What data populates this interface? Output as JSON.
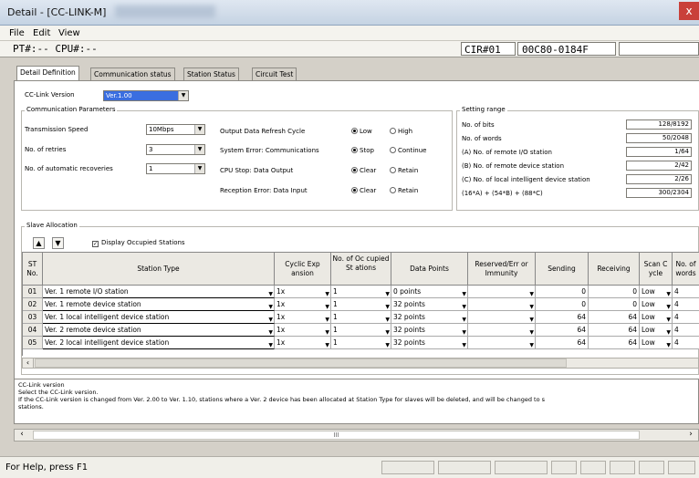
{
  "window": {
    "title": "Detail - [CC-LINK-M]",
    "close_glyph": "x"
  },
  "menu": [
    "File",
    "Edit",
    "View"
  ],
  "pt_bar": {
    "pt_label": "PT#:-- CPU#:--",
    "cir": "CIR#01",
    "code": "00C80-0184F"
  },
  "tabs": [
    "Detail Definition",
    "Communication status",
    "Station Status",
    "Circuit Test"
  ],
  "cc_link_version": {
    "label": "CC-Link Version",
    "value": "Ver.1.00"
  },
  "comm": {
    "group_title": "Communication Parameters",
    "transmission_speed": {
      "label": "Transmission Speed",
      "value": "10Mbps"
    },
    "retries": {
      "label": "No. of retries",
      "value": "3"
    },
    "recoveries": {
      "label": "No. of automatic recoveries",
      "value": "1"
    }
  },
  "options": [
    {
      "label": "Output Data Refresh Cycle",
      "opt1": "Low",
      "opt2": "High"
    },
    {
      "label": "System Error: Communications",
      "opt1": "Stop",
      "opt2": "Continue"
    },
    {
      "label": "CPU Stop: Data Output",
      "opt1": "Clear",
      "opt2": "Retain"
    },
    {
      "label": "Reception Error: Data Input",
      "opt1": "Clear",
      "opt2": "Retain"
    }
  ],
  "setting": {
    "title": "Setting range",
    "rows": [
      {
        "label": "No. of bits",
        "value": "128/8192"
      },
      {
        "label": "No. of words",
        "value": "50/2048"
      },
      {
        "label": "(A) No. of remote I/O station",
        "value": "1/64"
      },
      {
        "label": "(B) No. of remote device station",
        "value": "2/42"
      },
      {
        "label": "(C) No. of local intelligent device station",
        "value": "2/26"
      },
      {
        "label": "(16*A) + (54*B) + (88*C)",
        "value": "300/2304"
      }
    ]
  },
  "slave": {
    "group_title": "Slave Allocation",
    "up_arrow": "▲",
    "down_arrow": "▼",
    "display_occupied": "Display Occupied Stations",
    "headers": [
      "ST No.",
      "Station Type",
      "Cyclic Exp ansion",
      "No. of Oc cupied St ations",
      "Data Points",
      "Reserved/Err or Immunity",
      "Sending",
      "Receiving",
      "Scan C ycle",
      "No. of words"
    ],
    "rows": [
      {
        "st": "01",
        "type": "Ver. 1 remote I/O station",
        "cyclic": "1x",
        "occ": "1",
        "points": "0 points",
        "reserved": "",
        "sending": "0",
        "receiving": "0",
        "scan": "Low",
        "words": "4"
      },
      {
        "st": "02",
        "type": "Ver. 1 remote device station",
        "cyclic": "1x",
        "occ": "1",
        "points": "32 points",
        "reserved": "",
        "sending": "0",
        "receiving": "0",
        "scan": "Low",
        "words": "4"
      },
      {
        "st": "03",
        "type": "Ver. 1 local intelligent device station",
        "cyclic": "1x",
        "occ": "1",
        "points": "32 points",
        "reserved": "",
        "sending": "64",
        "receiving": "64",
        "scan": "Low",
        "words": "4"
      },
      {
        "st": "04",
        "type": "Ver. 2 remote device station",
        "cyclic": "1x",
        "occ": "1",
        "points": "32 points",
        "reserved": "",
        "sending": "64",
        "receiving": "64",
        "scan": "Low",
        "words": "4"
      },
      {
        "st": "05",
        "type": "Ver. 2 local intelligent device station",
        "cyclic": "1x",
        "occ": "1",
        "points": "32 points",
        "reserved": "",
        "sending": "64",
        "receiving": "64",
        "scan": "Low",
        "words": "4"
      }
    ]
  },
  "help": {
    "line1": "CC-Link version",
    "line2": "Select the CC-Link version.",
    "line3": "If the CC-Link version is changed from Ver. 2.00 to Ver. 1.10, stations where a Ver. 2 device has been allocated at Station Type for slaves will be deleted, and will be changed to s",
    "line4": "stations."
  },
  "scrollbar": {
    "left": "‹",
    "right": "›",
    "thumb": "III"
  },
  "status": {
    "text": "For Help, press F1"
  }
}
